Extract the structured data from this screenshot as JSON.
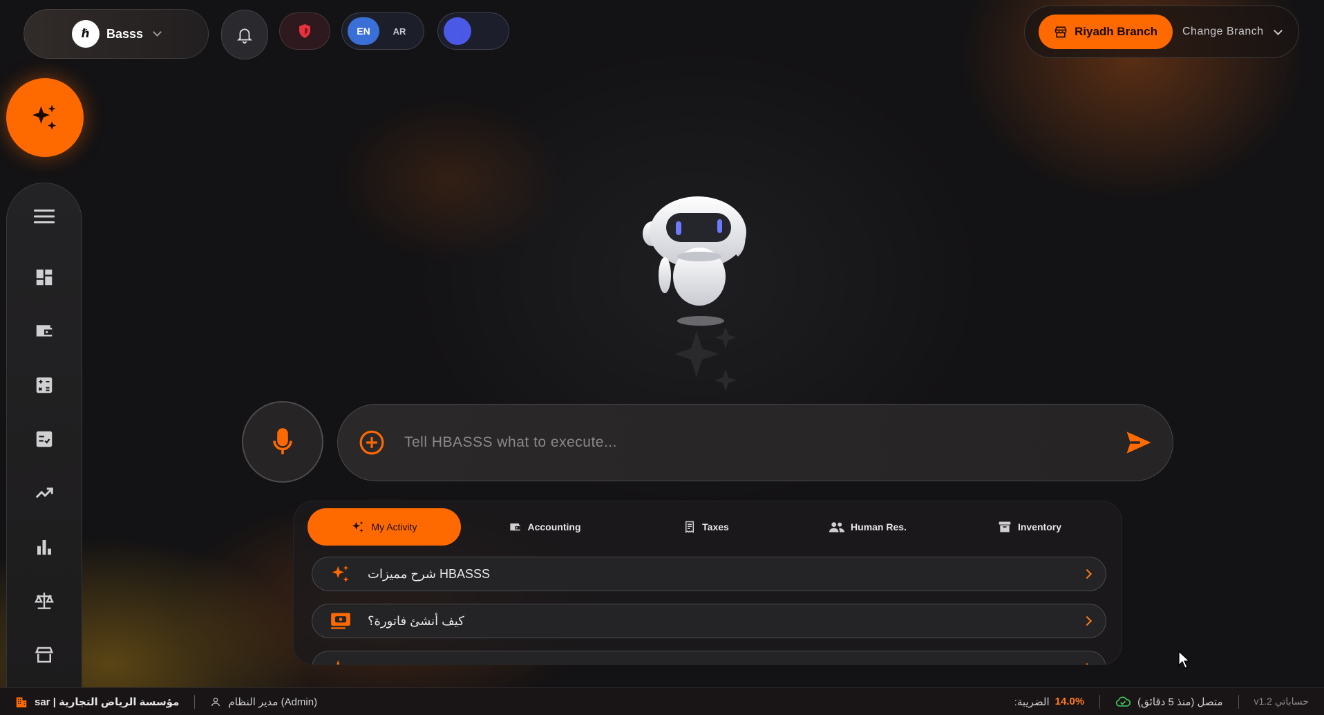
{
  "header": {
    "brand_logo": "ℏ",
    "brand_name": "Basss",
    "language": {
      "en": "EN",
      "ar": "AR"
    },
    "branch": {
      "current": "Riyadh Branch",
      "change_label": "Change Branch"
    }
  },
  "sidebar": {
    "items": [
      "menu-icon",
      "dashboard-icon",
      "wallet-icon",
      "calculator-icon",
      "checklist-icon",
      "trending-up-icon",
      "bar-chart-icon",
      "scale-icon",
      "store-icon"
    ]
  },
  "prompt": {
    "placeholder": "Tell HBASSS what to execute..."
  },
  "tabs": [
    {
      "label": "My Activity",
      "icon": "sparkle-icon",
      "active": true
    },
    {
      "label": "Accounting",
      "icon": "wallet-icon"
    },
    {
      "label": "Taxes",
      "icon": "receipt-icon"
    },
    {
      "label": "Human Res.",
      "icon": "people-icon"
    },
    {
      "label": "Inventory",
      "icon": "archive-icon"
    }
  ],
  "suggestions": [
    {
      "text": "شرح مميزات HBASSS",
      "icon": "sparkle-icon"
    },
    {
      "text": "كيف أنشئ فاتورة؟",
      "icon": "invoice-icon"
    },
    {
      "text": "...",
      "icon": "sparkle-icon"
    }
  ],
  "status_bar": {
    "company": "sar | مؤسسة الرياض التجارية",
    "user": "مدير النظام (Admin)",
    "tax_label": ":الضريبة",
    "tax_value": "14.0%",
    "connection": "متصل (منذ 5 دقائق)",
    "version": "v1.2 حساباتي"
  },
  "colors": {
    "accent": "#ff6a00",
    "background": "#131214",
    "lang_active": "#3a6fd8",
    "theme_knob": "#4a5ae6",
    "connection_ok": "#3fc45a"
  }
}
